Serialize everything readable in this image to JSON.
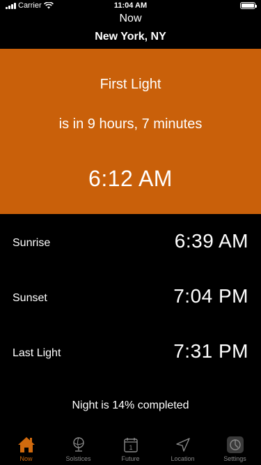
{
  "status_bar": {
    "carrier": "Carrier",
    "time": "11:04 AM"
  },
  "header": {
    "title": "Now",
    "location": "New York, NY"
  },
  "hero": {
    "event": "First Light",
    "countdown": "is in 9 hours, 7 minutes",
    "time": "6:12 AM",
    "color": "#c9600a"
  },
  "events": [
    {
      "label": "Sunrise",
      "time": "6:39 AM"
    },
    {
      "label": "Sunset",
      "time": "7:04 PM"
    },
    {
      "label": "Last Light",
      "time": "7:31 PM"
    }
  ],
  "progress_text": "Night is 14% completed",
  "tabs": [
    {
      "label": "Now",
      "icon": "home-icon",
      "active": true
    },
    {
      "label": "Solstices",
      "icon": "globe-icon",
      "active": false
    },
    {
      "label": "Future",
      "icon": "calendar-icon",
      "active": false
    },
    {
      "label": "Location",
      "icon": "location-arrow-icon",
      "active": false
    },
    {
      "label": "Settings",
      "icon": "settings-icon",
      "active": false
    }
  ],
  "accent_color": "#d06a0e"
}
